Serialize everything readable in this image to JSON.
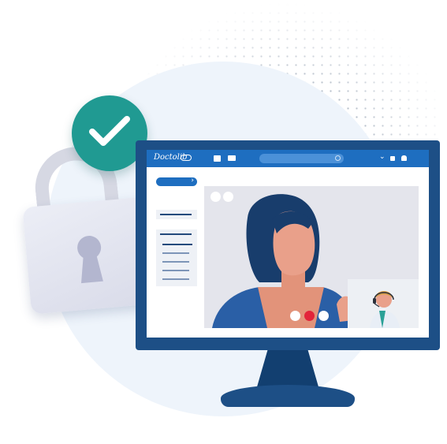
{
  "app": {
    "logo_text": "Doctolib"
  },
  "colors": {
    "monitor_frame": "#1d4f86",
    "topbar": "#1e6ec0",
    "check_badge": "#209a92",
    "end_call": "#e3243a",
    "lock": "#d9dbe9",
    "background_circle": "#eef4fb"
  },
  "icons": {
    "badge": "check-icon",
    "lock": "padlock-icon",
    "topbar": [
      "calendar-icon",
      "mail-icon",
      "search-icon",
      "chevron-down-icon",
      "lock-icon",
      "bell-icon"
    ],
    "call_controls": [
      "microphone-button",
      "end-call-button",
      "camera-button"
    ]
  }
}
